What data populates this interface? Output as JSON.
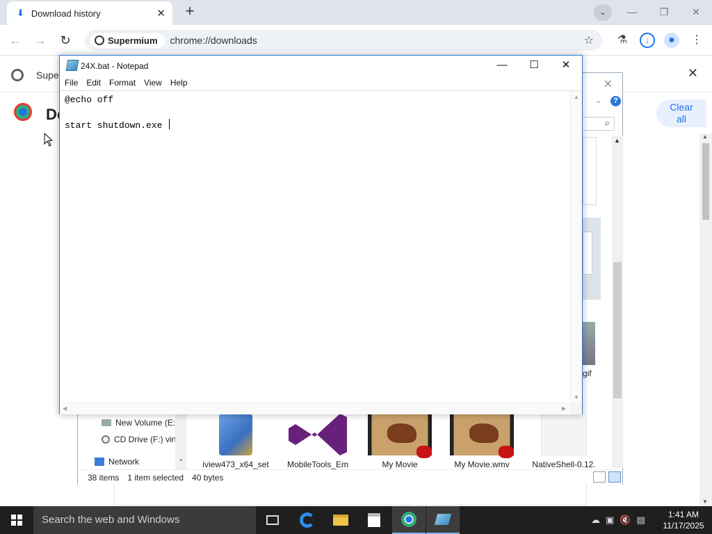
{
  "browser": {
    "tab_title": "Download history",
    "tab_close": "✕",
    "new_tab": "+",
    "tab_search": "⌄",
    "window_minimize": "—",
    "window_restore": "❐",
    "window_close": "✕",
    "back": "←",
    "forward": "→",
    "reload": "↻",
    "site_chip": "Supermium",
    "url": "chrome://downloads",
    "bookmark": "☆"
  },
  "downloads_page": {
    "bar_text": "Super",
    "heading": "Do",
    "clear_all_line1": "Clear",
    "clear_all_line2": "all"
  },
  "explorer": {
    "nav_items": [
      {
        "label": "New Volume (E:)"
      },
      {
        "label": "CD Drive (F:) virt"
      },
      {
        "label": "Network"
      }
    ],
    "files": [
      {
        "label": "iview473_x64_set"
      },
      {
        "label": "MobileTools_Em"
      },
      {
        "label": "My Movie"
      },
      {
        "label": "My Movie.wmv"
      },
      {
        "label": "NativeShell-0.12."
      }
    ],
    "partial_label": "gif",
    "status": {
      "items": "38 items",
      "selected": "1 item selected",
      "size": "40 bytes"
    },
    "colors": {
      "help": "#2a77d8",
      "vs_logo": "#68217a"
    }
  },
  "notepad": {
    "title": "24X.bat - Notepad",
    "menu": [
      "File",
      "Edit",
      "Format",
      "View",
      "Help"
    ],
    "line1": "@echo off",
    "line2": "",
    "line3": "start shutdown.exe "
  },
  "taskbar": {
    "search_placeholder": "Search the web and Windows",
    "time": "1:41 AM",
    "date": "11/17/2025",
    "accent": "#7db3e8"
  }
}
